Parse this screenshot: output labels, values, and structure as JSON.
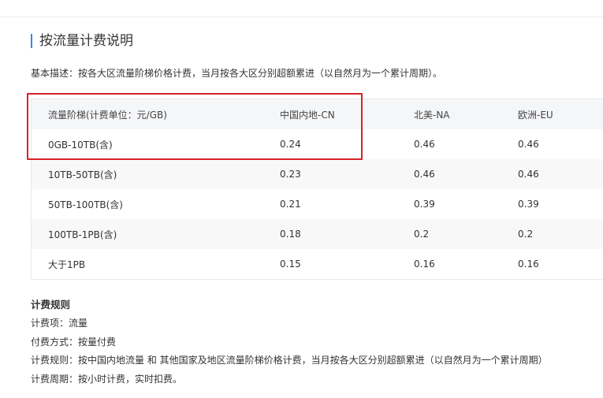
{
  "section": {
    "title": "按流量计费说明",
    "description": "基本描述：按各大区流量阶梯价格计费，当月按各大区分别超额累进（以自然月为一个累计周期）。"
  },
  "table": {
    "headers": [
      "流量阶梯(计费单位：元/GB)",
      "中国内地-CN",
      "北美-NA",
      "欧洲-EU"
    ],
    "rows": [
      [
        "0GB-10TB(含)",
        "0.24",
        "0.46",
        "0.46"
      ],
      [
        "10TB-50TB(含)",
        "0.23",
        "0.46",
        "0.46"
      ],
      [
        "50TB-100TB(含)",
        "0.21",
        "0.39",
        "0.39"
      ],
      [
        "100TB-1PB(含)",
        "0.18",
        "0.2",
        "0.2"
      ],
      [
        "大于1PB",
        "0.15",
        "0.16",
        "0.16"
      ]
    ]
  },
  "rules": {
    "title": "计费规则",
    "lines": [
      "计费项：流量",
      "付费方式：按量付费",
      "计费规则：按中国内地流量 和 其他国家及地区流量阶梯价格计费，当月按各大区分别超额累进（以自然月为一个累计周期）",
      "计费周期：按小时计费，实时扣费。"
    ]
  },
  "colors": {
    "accent": "#2b8cf0",
    "highlight": "#d9232a",
    "header_bg": "#f5f6f8",
    "alt_row_bg": "#f8f8f8"
  }
}
